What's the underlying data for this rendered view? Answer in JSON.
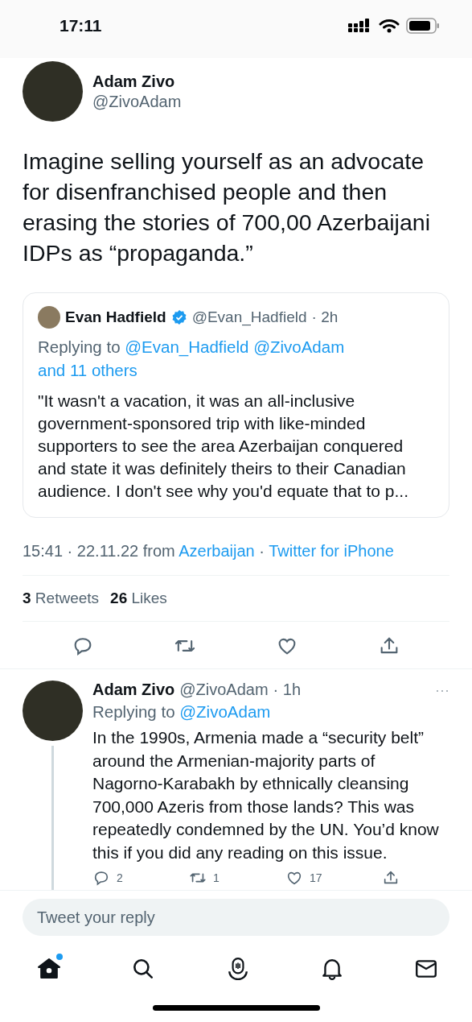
{
  "status_bar": {
    "time": "17:11"
  },
  "tweet": {
    "name": "Adam Zivo",
    "handle": "@ZivoAdam",
    "text": "Imagine selling yourself as an advocate for disenfranchised people and then erasing the stories of 700,00 Azerbaijani IDPs as “propaganda.”",
    "quote": {
      "name": "Evan Hadfield",
      "verified": true,
      "handle": "@Evan_Hadfield",
      "time": "· 2h",
      "replying_label": "Replying to",
      "replying_to": [
        "@Evan_Hadfield",
        "@ZivoAdam",
        "and 11 others"
      ],
      "text": "\"It wasn't a vacation, it was an all-inclusive government-sponsored trip with like-minded supporters to see the area Azerbaijan conquered and state it was definitely theirs to their Canadian audience. I don't see why you'd equate that to p..."
    },
    "timestamp": "15:41 · 22.11.22 from",
    "location": "Azerbaijan",
    "separator": "·",
    "client": "Twitter for iPhone",
    "stats": [
      {
        "count": "3",
        "label": "Retweets"
      },
      {
        "count": "26",
        "label": "Likes"
      }
    ],
    "actions": [
      {
        "kind": "reply"
      },
      {
        "kind": "retweet"
      },
      {
        "kind": "like"
      },
      {
        "kind": "share"
      }
    ]
  },
  "reply": {
    "name": "Adam Zivo",
    "handle": "@ZivoAdam",
    "time": "· 1h",
    "more": "···",
    "replying_label": "Replying to",
    "replying_to": "@ZivoAdam",
    "text": "In the 1990s, Armenia made a “security belt” around the Armenian-majority parts of Nagorno-Karabakh by ethnically cleansing 700,000 Azeris from those lands? This was repeatedly condemned by the UN. You’d know this if you did any reading on this issue.",
    "actions": [
      {
        "kind": "reply",
        "count": "2"
      },
      {
        "kind": "retweet",
        "count": "1"
      },
      {
        "kind": "like",
        "count": "17"
      },
      {
        "kind": "share"
      }
    ]
  },
  "composer": {
    "placeholder": "Tweet your reply"
  },
  "tab_bar": [
    {
      "kind": "home",
      "selected": true,
      "badge": true
    },
    {
      "kind": "search",
      "selected": false,
      "badge": false
    },
    {
      "kind": "spaces",
      "selected": false,
      "badge": false
    },
    {
      "kind": "notifications",
      "selected": false,
      "badge": false
    },
    {
      "kind": "messages",
      "selected": false,
      "badge": false
    }
  ]
}
